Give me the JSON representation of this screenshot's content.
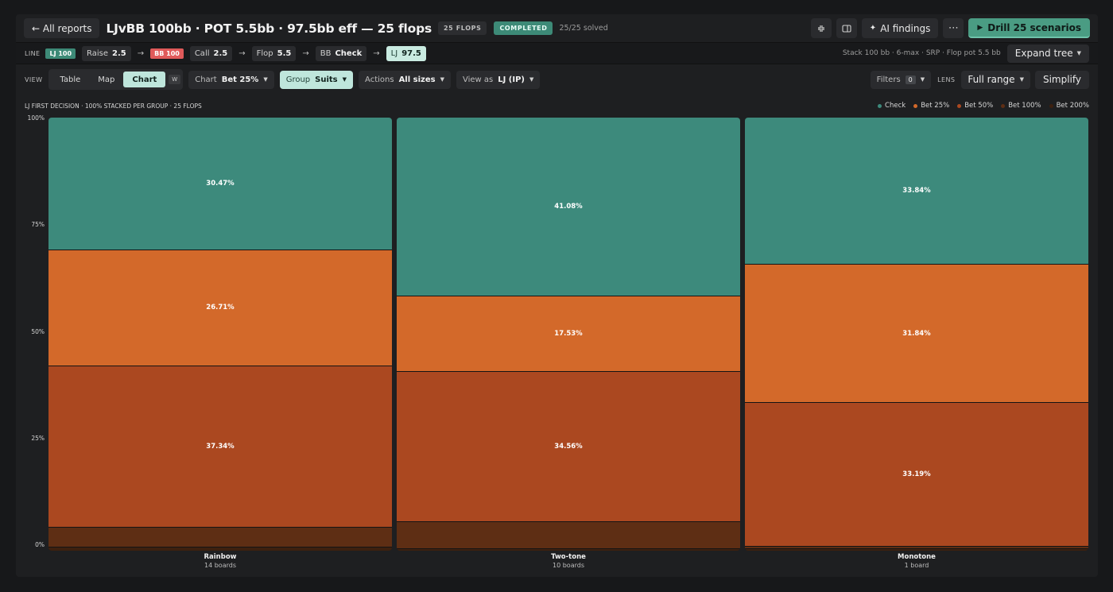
{
  "header": {
    "back_label": "← All reports",
    "title": "LJvBB 100bb · POT 5.5bb · 97.5bb eff — 25 flops",
    "flops_badge": "25 FLOPS",
    "status_badge": "COMPLETED",
    "solved_text": "25/25 solved",
    "ai_findings_label": "AI findings",
    "drill_label": "Drill 25 scenarios"
  },
  "line": {
    "label": "LINE",
    "steps": [
      {
        "kind": "badge",
        "text": "LJ 100",
        "color": "#3d8a77"
      },
      {
        "kind": "action",
        "name": "Raise",
        "value": "2.5"
      },
      {
        "kind": "badge",
        "text": "BB 100",
        "color": "#e05a5a"
      },
      {
        "kind": "action",
        "name": "Call",
        "value": "2.5"
      },
      {
        "kind": "action",
        "name": "Flop",
        "value": "5.5"
      },
      {
        "kind": "action",
        "name": "BB",
        "value": "Check"
      },
      {
        "kind": "current",
        "name": "LJ",
        "value": "97.5"
      }
    ],
    "summary": "Stack 100 bb · 6-max · SRP · Flop pot 5.5 bb",
    "expand_label": "Expand tree"
  },
  "view": {
    "label": "VIEW",
    "tabs": [
      "Table",
      "Map",
      "Chart"
    ],
    "active_tab": "Chart",
    "shortcut": "W",
    "chart_dd": {
      "label": "Chart",
      "value": "Bet 25%"
    },
    "group_dd": {
      "label": "Group",
      "value": "Suits"
    },
    "actions_dd": {
      "label": "Actions",
      "value": "All sizes"
    },
    "viewas_dd": {
      "label": "View as",
      "value": "LJ (IP)"
    },
    "filters_label": "Filters",
    "filters_count": "0",
    "lens_label": "LENS",
    "lens_value": "Full range",
    "simplify_label": "Simplify"
  },
  "chart_caption": "LJ FIRST DECISION · 100% STACKED PER GROUP · 25 FLOPS",
  "chart_data": {
    "type": "bar",
    "stacked": true,
    "normalized": true,
    "ylim": [
      0,
      100
    ],
    "yticks": [
      "100%",
      "75%",
      "50%",
      "25%",
      "0%"
    ],
    "categories": [
      "Rainbow",
      "Two-tone",
      "Monotone"
    ],
    "subcategories": [
      "14 boards",
      "10 boards",
      "1 board"
    ],
    "series": [
      {
        "name": "Check",
        "color": "#3d8a7c",
        "values": [
          30.47,
          41.08,
          33.84
        ]
      },
      {
        "name": "Bet 25%",
        "color": "#d3692a",
        "values": [
          26.71,
          17.53,
          31.84
        ]
      },
      {
        "name": "Bet 50%",
        "color": "#ab4820",
        "values": [
          37.34,
          34.56,
          33.19
        ]
      },
      {
        "name": "Bet 100%",
        "color": "#5e2e14",
        "values": [
          4.6,
          6.2,
          0.6
        ]
      },
      {
        "name": "Bet 200%",
        "color": "#3d200f",
        "values": [
          0.88,
          0.63,
          0.53
        ]
      }
    ],
    "labeled_series": [
      "Check",
      "Bet 25%",
      "Bet 50%"
    ]
  }
}
